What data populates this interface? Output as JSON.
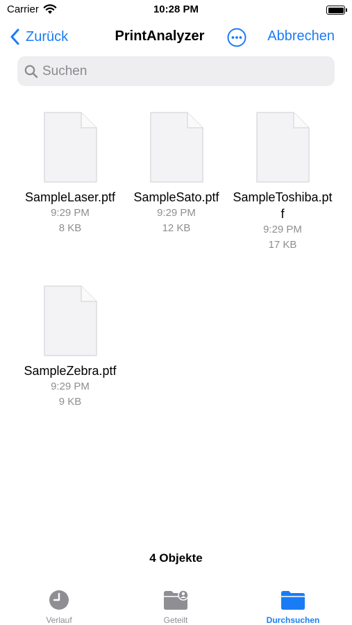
{
  "status_bar": {
    "carrier": "Carrier",
    "time": "10:28 PM"
  },
  "nav": {
    "back_label": "Zurück",
    "title": "PrintAnalyzer",
    "cancel_label": "Abbrechen"
  },
  "search": {
    "placeholder": "Suchen"
  },
  "files": [
    {
      "name": "SampleLaser.ptf",
      "time": "9:29 PM",
      "size": "8 KB"
    },
    {
      "name": "SampleSato.ptf",
      "time": "9:29 PM",
      "size": "12 KB"
    },
    {
      "name": "SampleToshiba.ptf",
      "time": "9:29 PM",
      "size": "17 KB"
    },
    {
      "name": "SampleZebra.ptf",
      "time": "9:29 PM",
      "size": "9 KB"
    }
  ],
  "footer": {
    "count": "4 Objekte"
  },
  "tabs": [
    {
      "label": "Verlauf",
      "icon": "clock-icon",
      "active": false
    },
    {
      "label": "Geteilt",
      "icon": "shared-folder-icon",
      "active": false
    },
    {
      "label": "Durchsuchen",
      "icon": "folder-icon",
      "active": true
    }
  ],
  "colors": {
    "accent": "#1a7cf5",
    "inactive": "#8e8e93",
    "search_bg": "#eeeef0"
  }
}
